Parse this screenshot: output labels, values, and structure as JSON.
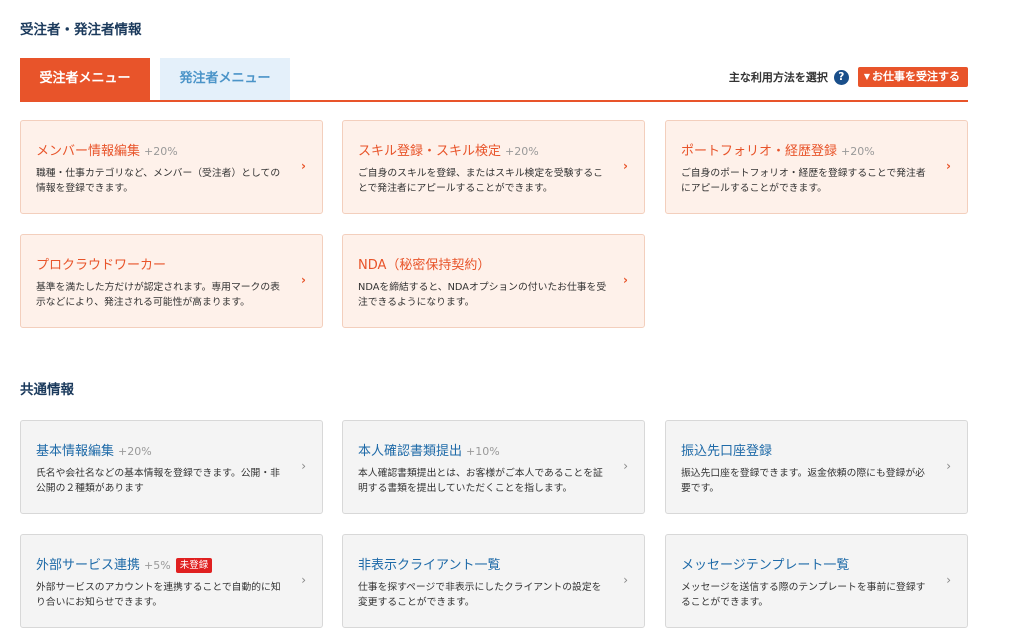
{
  "contractor_section": {
    "title": "受注者・発注者情報",
    "tabs": [
      {
        "label": "受注者メニュー"
      },
      {
        "label": "発注者メニュー"
      }
    ],
    "usage_label": "主な利用方法を選択",
    "help_icon": "?",
    "usage_button": "お仕事を受注する",
    "cards": [
      {
        "title": "メンバー情報編集",
        "bonus": "+20%",
        "desc": "職種・仕事カテゴリなど、メンバー（受注者）としての情報を登録できます。"
      },
      {
        "title": "スキル登録・スキル検定",
        "bonus": "+20%",
        "desc": "ご自身のスキルを登録、またはスキル検定を受験することで発注者にアピールすることができます。"
      },
      {
        "title": "ポートフォリオ・経歴登録",
        "bonus": "+20%",
        "desc": "ご自身のポートフォリオ・経歴を登録することで発注者にアピールすることができます。"
      },
      {
        "title": "プロクラウドワーカー",
        "bonus": "",
        "desc": "基準を満たした方だけが認定されます。専用マークの表示などにより、発注される可能性が高まります。"
      },
      {
        "title": "NDA（秘密保持契約）",
        "bonus": "",
        "desc": "NDAを締結すると、NDAオプションの付いたお仕事を受注できるようになります。"
      }
    ]
  },
  "common_section": {
    "title": "共通情報",
    "cards": [
      {
        "title": "基本情報編集",
        "bonus": "+20%",
        "badge": "",
        "desc": "氏名や会社名などの基本情報を登録できます。公開・非公開の２種類があります"
      },
      {
        "title": "本人確認書類提出",
        "bonus": "+10%",
        "badge": "",
        "desc": "本人確認書類提出とは、お客様がご本人であることを証明する書類を提出していただくことを指します。"
      },
      {
        "title": "振込先口座登録",
        "bonus": "",
        "badge": "",
        "desc": "振込先口座を登録できます。返金依頼の際にも登録が必要です。"
      },
      {
        "title": "外部サービス連携",
        "bonus": "+5%",
        "badge": "未登録",
        "desc": "外部サービスのアカウントを連携することで自動的に知り合いにお知らせできます。"
      },
      {
        "title": "非表示クライアント一覧",
        "bonus": "",
        "badge": "",
        "desc": "仕事を探すページで非表示にしたクライアントの設定を変更することができます。"
      },
      {
        "title": "メッセージテンプレート一覧",
        "bonus": "",
        "badge": "",
        "desc": "メッセージを送信する際のテンプレートを事前に登録することができます。"
      }
    ]
  },
  "colors": {
    "accent": "#e8542a",
    "link_blue": "#1e6aa8",
    "heading": "#1b3a5c"
  }
}
